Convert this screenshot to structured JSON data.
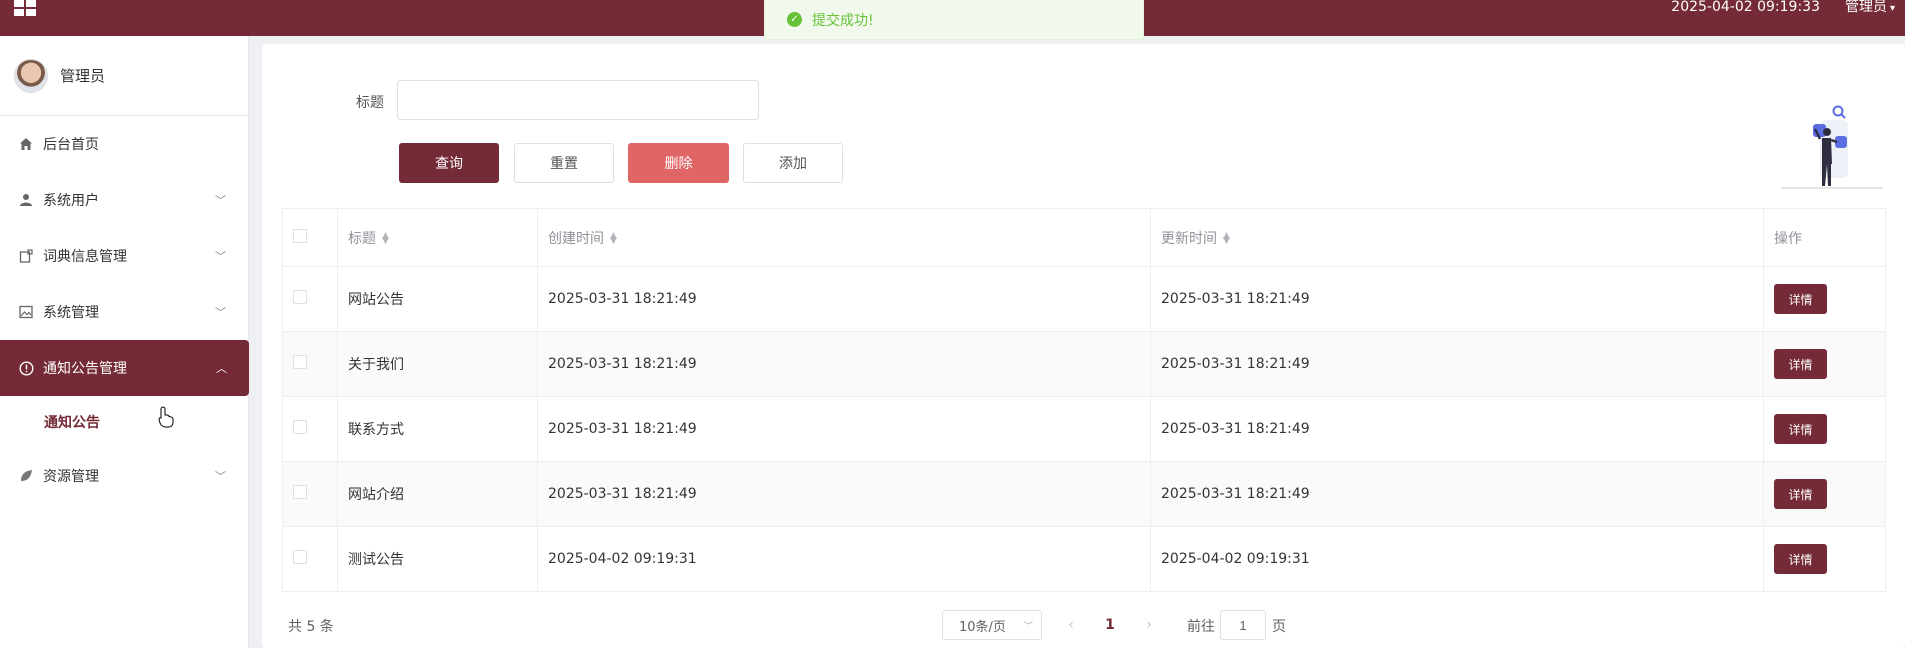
{
  "topbar": {
    "datetime": "2025-04-02 09:19:33",
    "user": "管理员"
  },
  "toast": {
    "message": "提交成功!",
    "color": "#67c23a"
  },
  "sidebar": {
    "profile_name": "管理员",
    "items": [
      {
        "label": "后台首页",
        "icon": "home-icon"
      },
      {
        "label": "系统用户",
        "icon": "user-icon"
      },
      {
        "label": "词典信息管理",
        "icon": "dictionary-icon"
      },
      {
        "label": "系统管理",
        "icon": "image-icon"
      },
      {
        "label": "通知公告管理",
        "icon": "warning-circle-icon",
        "active": true
      },
      {
        "label": "资源管理",
        "icon": "leaf-icon"
      }
    ],
    "subitem": "通知公告"
  },
  "search": {
    "label": "标题",
    "value": "",
    "placeholder": ""
  },
  "buttons": {
    "query": "查询",
    "reset": "重置",
    "delete": "删除",
    "add": "添加"
  },
  "table": {
    "headers": {
      "title": "标题",
      "created": "创建时间",
      "updated": "更新时间",
      "action": "操作"
    },
    "rows": [
      {
        "title": "网站公告",
        "created": "2025-03-31 18:21:49",
        "updated": "2025-03-31 18:21:49",
        "action": "详情"
      },
      {
        "title": "关于我们",
        "created": "2025-03-31 18:21:49",
        "updated": "2025-03-31 18:21:49",
        "action": "详情"
      },
      {
        "title": "联系方式",
        "created": "2025-03-31 18:21:49",
        "updated": "2025-03-31 18:21:49",
        "action": "详情"
      },
      {
        "title": "网站介绍",
        "created": "2025-03-31 18:21:49",
        "updated": "2025-03-31 18:21:49",
        "action": "详情"
      },
      {
        "title": "测试公告",
        "created": "2025-04-02 09:19:31",
        "updated": "2025-04-02 09:19:31",
        "action": "详情"
      }
    ]
  },
  "pagination": {
    "total": "共 5 条",
    "page_size": "10条/页",
    "current_page": "1",
    "goto_label": "前往",
    "goto_value": "1",
    "goto_suffix": "页"
  },
  "colors": {
    "brand": "#742a37",
    "danger": "#e06666"
  }
}
